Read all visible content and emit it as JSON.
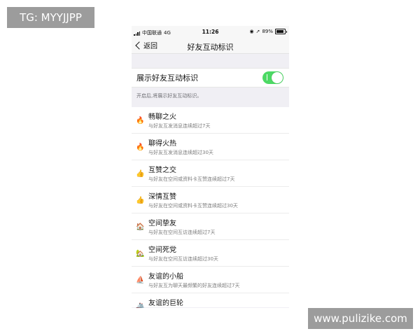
{
  "watermarks": {
    "top_left": "TG: MYYJJPP",
    "bottom_right": "www.pulizike.com"
  },
  "status_bar": {
    "carrier": "中国联通",
    "network": "4G",
    "time": "11:26",
    "battery": "89%"
  },
  "nav": {
    "back_label": "返回",
    "title": "好友互动标识"
  },
  "toggle": {
    "label": "展示好友互动标识",
    "state": "on",
    "accent": "#4cd964"
  },
  "hint": "开启后,将展示好友互动标识。",
  "items": [
    {
      "title": "畅聊之火",
      "desc": "与好友互发消息连续超过7天",
      "icon": "small-flame-icon",
      "glyph": "🔥"
    },
    {
      "title": "聊得火热",
      "desc": "与好友互发消息连续超过30天",
      "icon": "big-flame-icon",
      "glyph": "🔥"
    },
    {
      "title": "互赞之交",
      "desc": "与好友在空间或资料卡互赞连续超过7天",
      "icon": "small-thumb-icon",
      "glyph": "👍"
    },
    {
      "title": "深情互赞",
      "desc": "与好友在空间或资料卡互赞连续超过30天",
      "icon": "big-thumb-icon",
      "glyph": "👍"
    },
    {
      "title": "空间挚友",
      "desc": "与好友在空间互访连续超过7天",
      "icon": "small-house-icon",
      "glyph": "🏠"
    },
    {
      "title": "空间死党",
      "desc": "与好友在空间互访连续超过30天",
      "icon": "big-house-icon",
      "glyph": "🏡"
    },
    {
      "title": "友谊的小船",
      "desc": "与好友互为聊天最频繁的好友连续超过7天",
      "icon": "small-boat-icon",
      "glyph": "⛵"
    },
    {
      "title": "友谊的巨轮",
      "desc": "",
      "icon": "big-ship-icon",
      "glyph": "🚢"
    }
  ]
}
